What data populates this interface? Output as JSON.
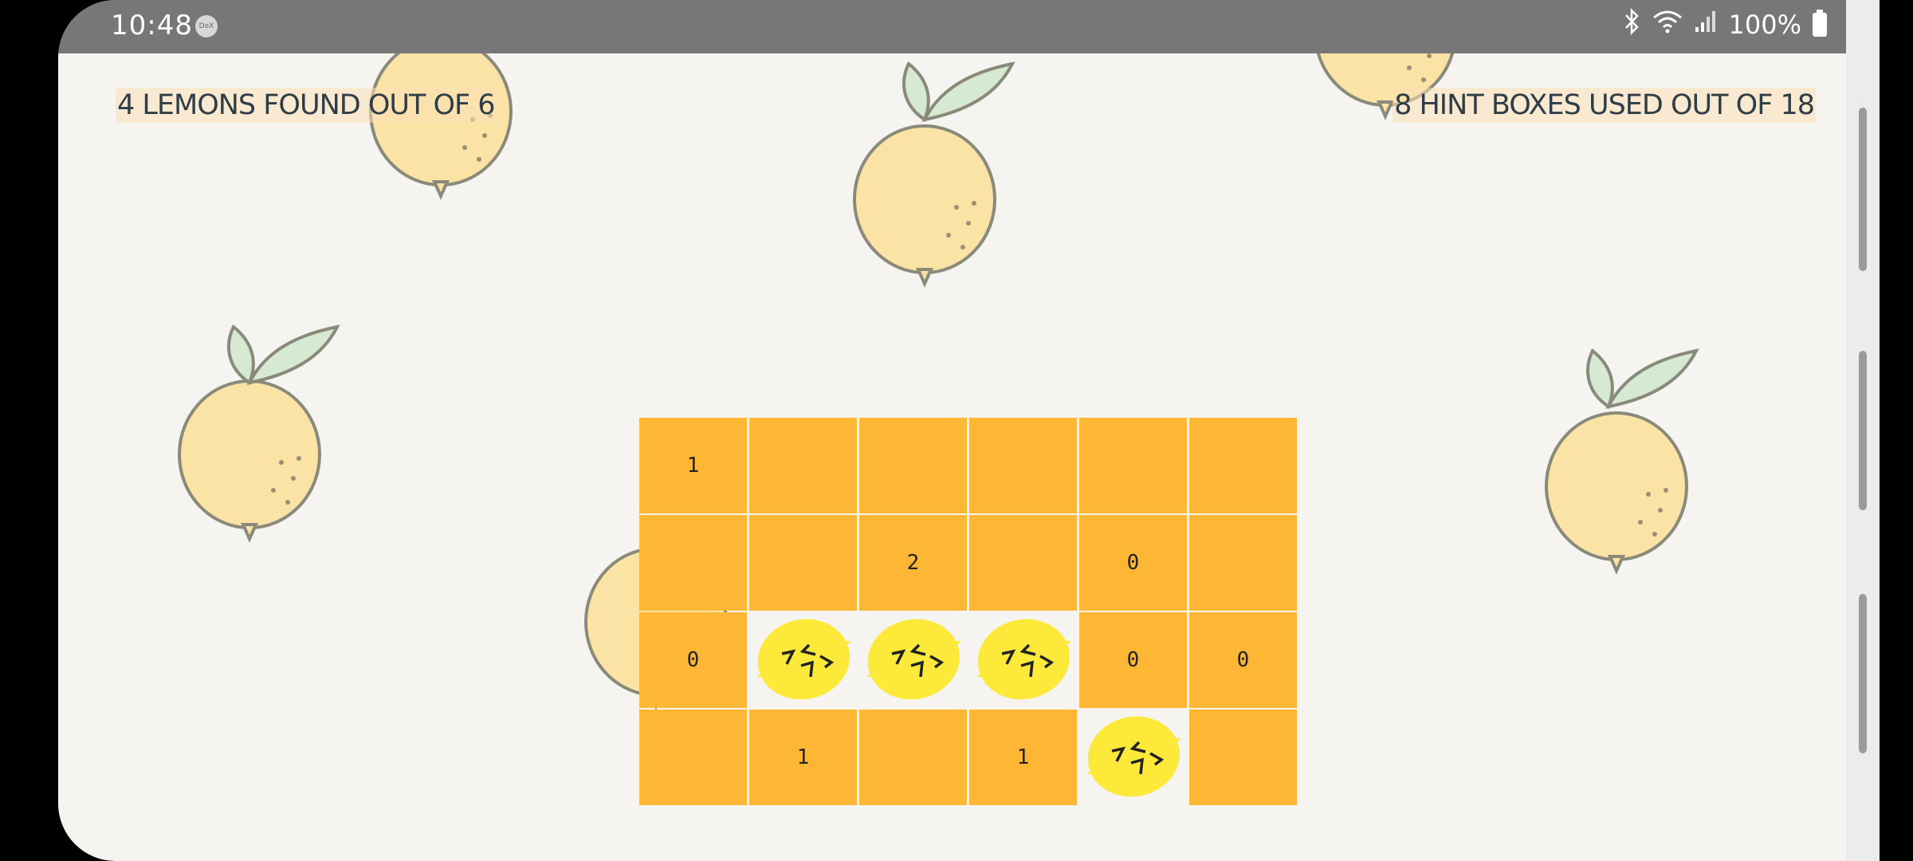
{
  "status_bar": {
    "time": "10:48",
    "dex_badge": "DeX",
    "battery": "100%",
    "icons": [
      "bluetooth-icon",
      "wifi-icon",
      "signal-icon",
      "battery-icon"
    ]
  },
  "game": {
    "lemons_found_text": "4 LEMONS FOUND OUT OF 6",
    "hints_used_text": "8 HINT BOXES USED OUT OF 18",
    "grid": {
      "rows": 4,
      "cols": 6,
      "cells": [
        [
          {
            "state": "hidden",
            "label": "1"
          },
          {
            "state": "hidden",
            "label": ""
          },
          {
            "state": "hidden",
            "label": ""
          },
          {
            "state": "hidden",
            "label": ""
          },
          {
            "state": "hidden",
            "label": ""
          },
          {
            "state": "hidden",
            "label": ""
          }
        ],
        [
          {
            "state": "hidden",
            "label": ""
          },
          {
            "state": "hidden",
            "label": ""
          },
          {
            "state": "hidden",
            "label": "2"
          },
          {
            "state": "hidden",
            "label": ""
          },
          {
            "state": "hidden",
            "label": "0"
          },
          {
            "state": "hidden",
            "label": ""
          }
        ],
        [
          {
            "state": "hidden",
            "label": "0"
          },
          {
            "state": "lemon",
            "label": ""
          },
          {
            "state": "lemon",
            "label": ""
          },
          {
            "state": "lemon",
            "label": ""
          },
          {
            "state": "hidden",
            "label": "0"
          },
          {
            "state": "hidden",
            "label": "0"
          }
        ],
        [
          {
            "state": "hidden",
            "label": ""
          },
          {
            "state": "hidden",
            "label": "1"
          },
          {
            "state": "hidden",
            "label": ""
          },
          {
            "state": "hidden",
            "label": "1"
          },
          {
            "state": "lemon",
            "label": ""
          },
          {
            "state": "hidden",
            "label": ""
          }
        ]
      ]
    }
  },
  "colors": {
    "background": "#f5f4f1",
    "cell": "#fdb734",
    "lemon": "#fde93a",
    "text": "#2f3e46",
    "status_bar": "#777777"
  }
}
